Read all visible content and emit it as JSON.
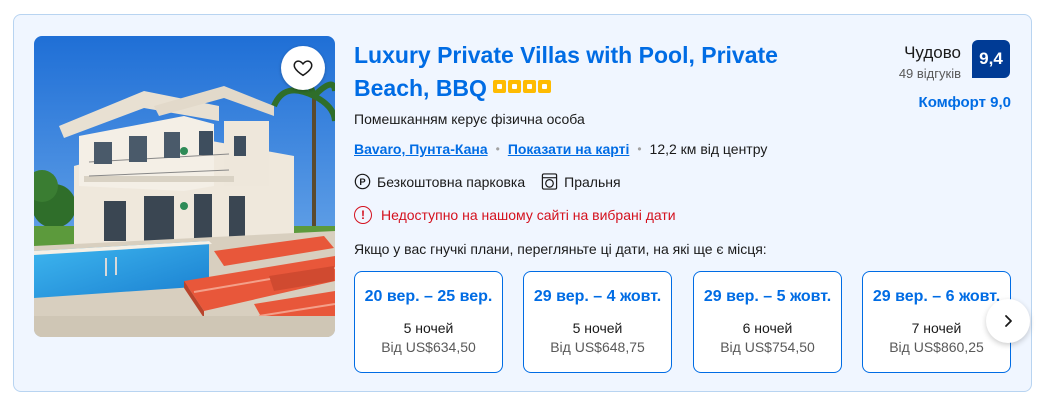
{
  "property": {
    "title": "Luxury Private Villas with Pool, Private Beach, BBQ",
    "star_count": 4,
    "managed_by": "Помешканням керує фізична особа",
    "location_link": "Bavaro, Пунта-Кана",
    "map_link": "Показати на карті",
    "distance": "12,2 км від центру",
    "facilities": [
      {
        "icon": "parking-icon",
        "label": "Безкоштовна парковка"
      },
      {
        "icon": "laundry-icon",
        "label": "Пральня"
      }
    ],
    "unavailable_notice": "Недоступно на нашому сайті на вибрані дати",
    "flexible_note": "Якщо у вас гнучкі плани, перегляньте ці дати, на які ще є місця:"
  },
  "review": {
    "word": "Чудово",
    "count": "49 відгуків",
    "score": "9,4",
    "comfort": "Комфорт 9,0"
  },
  "alt_dates": [
    {
      "range": "20 вер. – 25 вер.",
      "nights": "5 ночей",
      "price": "Від US$634,50"
    },
    {
      "range": "29 вер. – 4 жовт.",
      "nights": "5 ночей",
      "price": "Від US$648,75"
    },
    {
      "range": "29 вер. – 5 жовт.",
      "nights": "6 ночей",
      "price": "Від US$754,50"
    },
    {
      "range": "29 вер. – 6 жовт.",
      "nights": "7 ночей",
      "price": "Від US$860,25"
    }
  ],
  "colors": {
    "brand_blue": "#006ce4",
    "score_bg": "#003b95",
    "star_yellow": "#febb02",
    "error_red": "#d4111e"
  }
}
